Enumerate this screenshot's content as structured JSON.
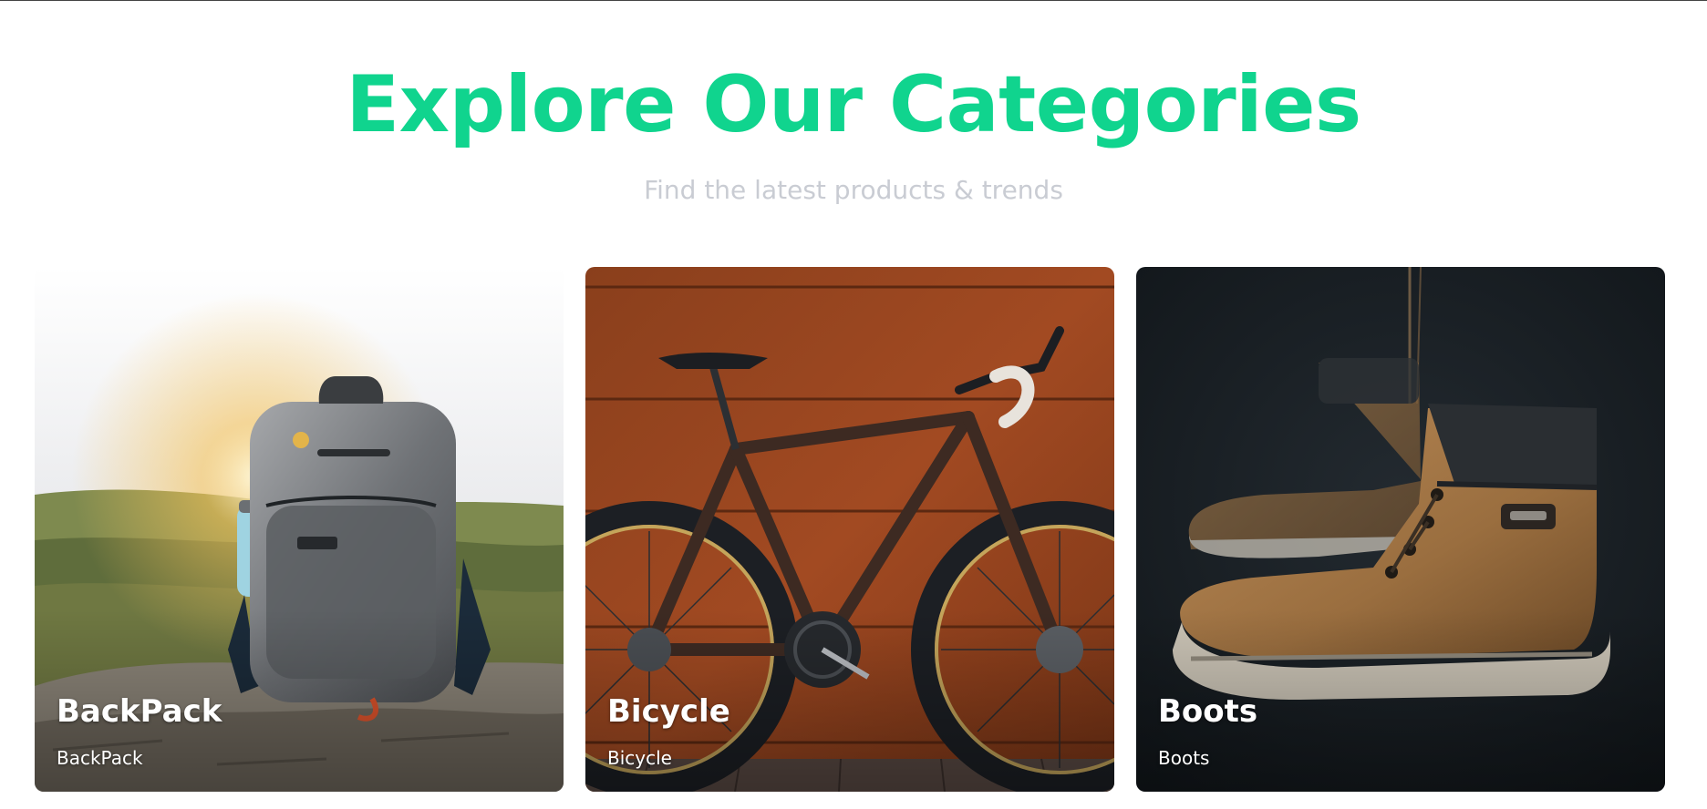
{
  "colors": {
    "accent": "#10d48e",
    "subtitle": "#c9ccd3",
    "card_text": "#ffffff"
  },
  "hero": {
    "title": "Explore Our Categories",
    "subtitle": "Find the latest products & trends"
  },
  "categories": [
    {
      "title": "BackPack",
      "subtitle": "BackPack",
      "image": "backpack-on-rock-photo"
    },
    {
      "title": "Bicycle",
      "subtitle": "Bicycle",
      "image": "road-bike-against-wood-wall-photo"
    },
    {
      "title": "Boots",
      "subtitle": "Boots",
      "image": "hanging-leather-boots-photo"
    }
  ]
}
